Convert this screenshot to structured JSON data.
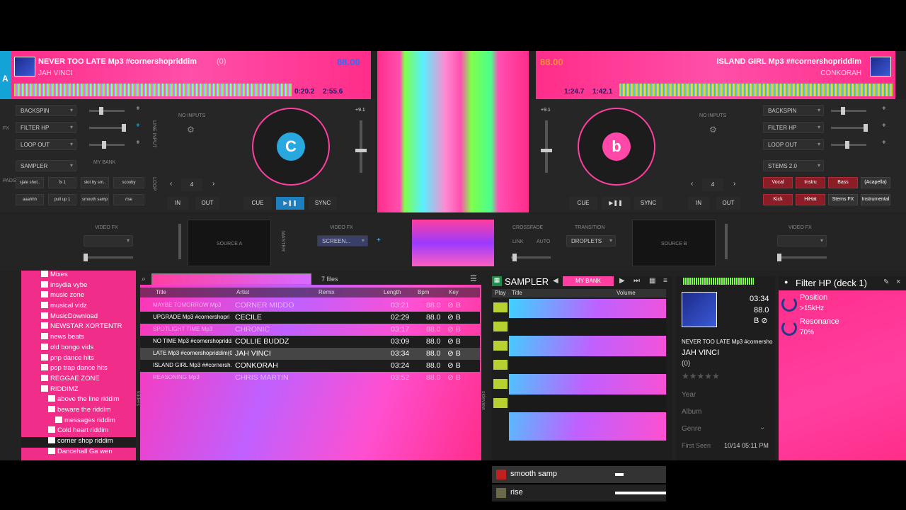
{
  "deck_a": {
    "letter": "A",
    "title": "NEVER TOO LATE Mp3 #cornershopriddim",
    "title_suffix": "(0)",
    "artist": "JAH VINCI",
    "bpm": "88.00",
    "time_elapsed": "0:20.2",
    "time_remain": "2:55.6",
    "effects": [
      "BACKSPIN",
      "FILTER HP",
      "LOOP OUT"
    ],
    "sampler_label": "SAMPLER",
    "pads": [
      "sjale shot..",
      "fx 1",
      "slot by sm..",
      "scooby",
      "aaahhh",
      "pull up 1",
      "smooth samp",
      "rise"
    ],
    "no_inputs": "NO INPUTS",
    "loop_size": "4",
    "cue": "CUE",
    "play": "▶❚❚",
    "sync": "SYNC",
    "in": "IN",
    "out": "OUT",
    "pitch": "+9.1",
    "line_input": "LINE INPUT",
    "pads_label": "PADS",
    "fx_label": "FX",
    "loop_label": "LOOP",
    "bank": "MY BANK"
  },
  "deck_b": {
    "title": "ISLAND GIRL Mp3 ##cornershopriddim",
    "artist": "CONKORAH",
    "bpm": "88.00",
    "time_elapsed": "1:24.7",
    "time_remain": "1:42.1",
    "effects": [
      "BACKSPIN",
      "FILTER HP",
      "LOOP OUT"
    ],
    "stems_label": "STEMS 2.0",
    "stems": [
      "Vocal",
      "Instru",
      "Bass",
      "(Acapella)",
      "Kick",
      "HiHat",
      "Stems FX",
      "Instrumental"
    ],
    "no_inputs": "NO INPUTS",
    "loop_size": "4",
    "cue": "CUE",
    "play": "▶❚❚",
    "sync": "SYNC",
    "in": "IN",
    "out": "OUT",
    "pitch": "+9.1"
  },
  "video": {
    "fx_left": "VIDEO FX",
    "fx_right": "VIDEO FX",
    "fx_mid": "VIDEO FX",
    "screen": "SCREEN...",
    "source_a": "SOURCE A",
    "source_b": "SOURCE B",
    "crossfade": "CROSSFADE",
    "link": "LINK",
    "auto": "AUTO",
    "transition": "TRANSITION",
    "droplets": "DROPLETS",
    "master": "MASTER"
  },
  "tree": [
    "Mixes",
    "insydia vybe",
    "music zone",
    "musical vidz",
    "MusicDownload",
    "NEWSTAR XORTENTR",
    "news beats",
    "old bongo vids",
    "pnp dance hits",
    "pop trap dance hits",
    "REGGAE ZONE",
    "RIDDIMZ",
    "above the line riddim",
    "beware the riddim",
    "messages riddim",
    "Cold heart riddim",
    "corner shop riddim",
    "Dancehall Ga wen"
  ],
  "browser": {
    "count": "7 files",
    "columns": [
      "Title",
      "Artist",
      "Remix",
      "Length",
      "Bpm",
      "Key"
    ],
    "rows": [
      {
        "title": "MAYBE TOMORROW Mp3",
        "artist": "CORNER MIDDO",
        "length": "03:21",
        "bpm": "88.0",
        "key": "⊘ B"
      },
      {
        "title": "UPGRADE Mp3 #cornershopri",
        "artist": "CECILE",
        "length": "02:29",
        "bpm": "88.0",
        "key": "⊘ B"
      },
      {
        "title": "SPOTLIGHT TIME Mp3",
        "artist": "CHRONIC",
        "length": "03:17",
        "bpm": "88.0",
        "key": "⊘ B"
      },
      {
        "title": "NO TIME Mp3 #cornershopridd...",
        "artist": "COLLIE BUDDZ",
        "length": "03:09",
        "bpm": "88.0",
        "key": "⊘ B"
      },
      {
        "title": "LATE Mp3 #cornershopriddim(0)",
        "artist": "JAH VINCI",
        "length": "03:34",
        "bpm": "88.0",
        "key": "⊘ B"
      },
      {
        "title": "ISLAND GIRL Mp3 ##cornersh...",
        "artist": "CONKORAH",
        "length": "03:24",
        "bpm": "88.0",
        "key": "⊘ B"
      },
      {
        "title": "REASONING Mp3",
        "artist": "CHRIS MARTIN",
        "length": "03:52",
        "bpm": "88.0",
        "key": "⊘ B"
      }
    ]
  },
  "sampler": {
    "title": "SAMPLER",
    "bank": "MY BANK",
    "col_play": "Play",
    "col_title": "Title",
    "col_volume": "Volume",
    "items": [
      "",
      "",
      "",
      "",
      "",
      "",
      "smooth samp",
      "rise"
    ],
    "side": "sideview",
    "folders": "folders"
  },
  "info": {
    "length": "03:34",
    "bpm": "88.0",
    "key": "B ⊘",
    "title": "NEVER TOO LATE Mp3 #cornersho",
    "artist": "JAH VINCI",
    "remix": "(0)",
    "year": "Year",
    "album": "Album",
    "genre": "Genre",
    "first_seen_label": "First Seen",
    "first_seen": "10/14 05:11 PM",
    "stars": "★★★★★"
  },
  "filter": {
    "title": "Filter HP (deck 1)",
    "position_label": "Position",
    "position": ">15kHz",
    "resonance_label": "Resonance",
    "resonance": "70%"
  },
  "colors": {
    "accent": "#ff2d8a",
    "panel": "#222222"
  }
}
